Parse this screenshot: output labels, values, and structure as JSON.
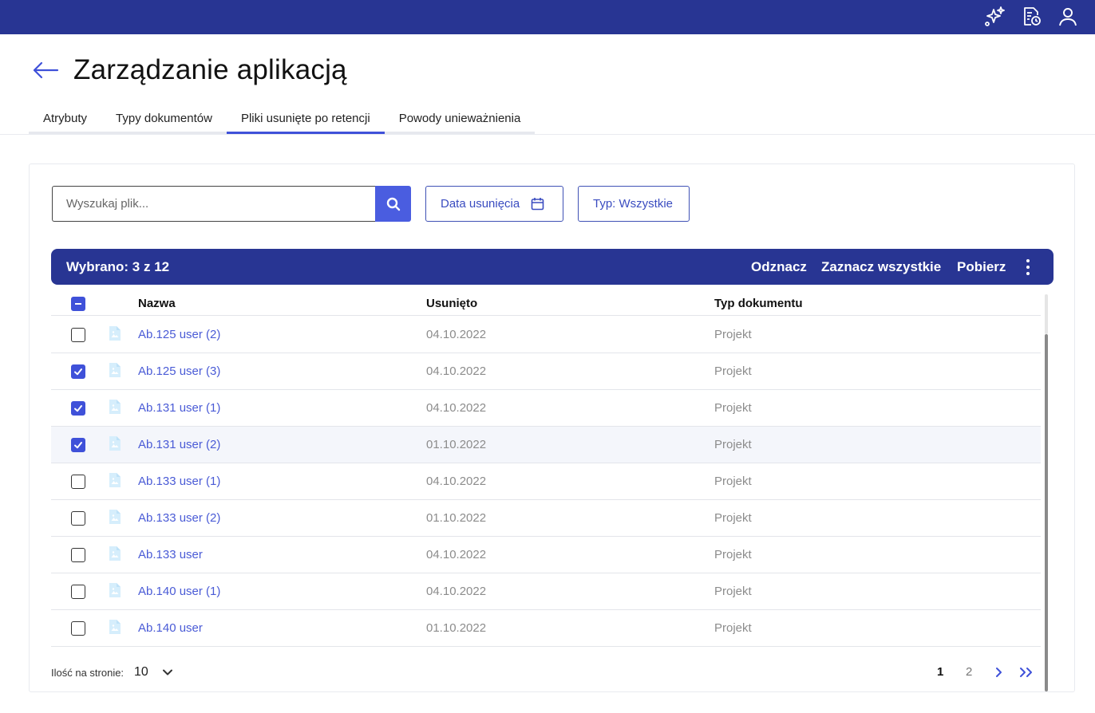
{
  "header": {
    "icons": [
      "sparkles-icon",
      "document-clock-icon",
      "user-icon"
    ]
  },
  "page": {
    "title": "Zarządzanie aplikacją"
  },
  "tabs": [
    {
      "label": "Atrybuty",
      "active": false
    },
    {
      "label": "Typy dokumentów",
      "active": false
    },
    {
      "label": "Pliki usunięte po retencji",
      "active": true
    },
    {
      "label": "Powody unieważnienia",
      "active": false
    }
  ],
  "toolbar": {
    "search_placeholder": "Wyszukaj plik...",
    "date_filter_label": "Data usunięcia",
    "type_filter_label": "Typ: Wszystkie"
  },
  "selection_bar": {
    "count_label": "Wybrano: 3 z 12",
    "deselect_label": "Odznacz",
    "select_all_label": "Zaznacz wszystkie",
    "download_label": "Pobierz"
  },
  "table": {
    "columns": {
      "name": "Nazwa",
      "deleted": "Usunięto",
      "doc_type": "Typ dokumentu"
    },
    "rows": [
      {
        "name": "Ab.125 user (2)",
        "deleted": "04.10.2022",
        "doc_type": "Projekt",
        "checked": false
      },
      {
        "name": "Ab.125 user (3)",
        "deleted": "04.10.2022",
        "doc_type": "Projekt",
        "checked": true
      },
      {
        "name": "Ab.131 user (1)",
        "deleted": "04.10.2022",
        "doc_type": "Projekt",
        "checked": true
      },
      {
        "name": "Ab.131 user (2)",
        "deleted": "01.10.2022",
        "doc_type": "Projekt",
        "checked": true
      },
      {
        "name": "Ab.133 user (1)",
        "deleted": "04.10.2022",
        "doc_type": "Projekt",
        "checked": false
      },
      {
        "name": "Ab.133 user (2)",
        "deleted": "01.10.2022",
        "doc_type": "Projekt",
        "checked": false
      },
      {
        "name": "Ab.133 user",
        "deleted": "04.10.2022",
        "doc_type": "Projekt",
        "checked": false
      },
      {
        "name": "Ab.140 user (1)",
        "deleted": "04.10.2022",
        "doc_type": "Projekt",
        "checked": false
      },
      {
        "name": "Ab.140 user",
        "deleted": "01.10.2022",
        "doc_type": "Projekt",
        "checked": false
      }
    ]
  },
  "pagination": {
    "per_page_label": "Ilość na stronie:",
    "per_page_value": "10",
    "pages": [
      "1",
      "2"
    ],
    "current_page": "1"
  },
  "colors": {
    "header_bg": "#283593",
    "accent": "#3f51d9",
    "link": "#4a5bd6",
    "muted_text": "#8c8c8c",
    "file_icon": "#d6eefc"
  }
}
